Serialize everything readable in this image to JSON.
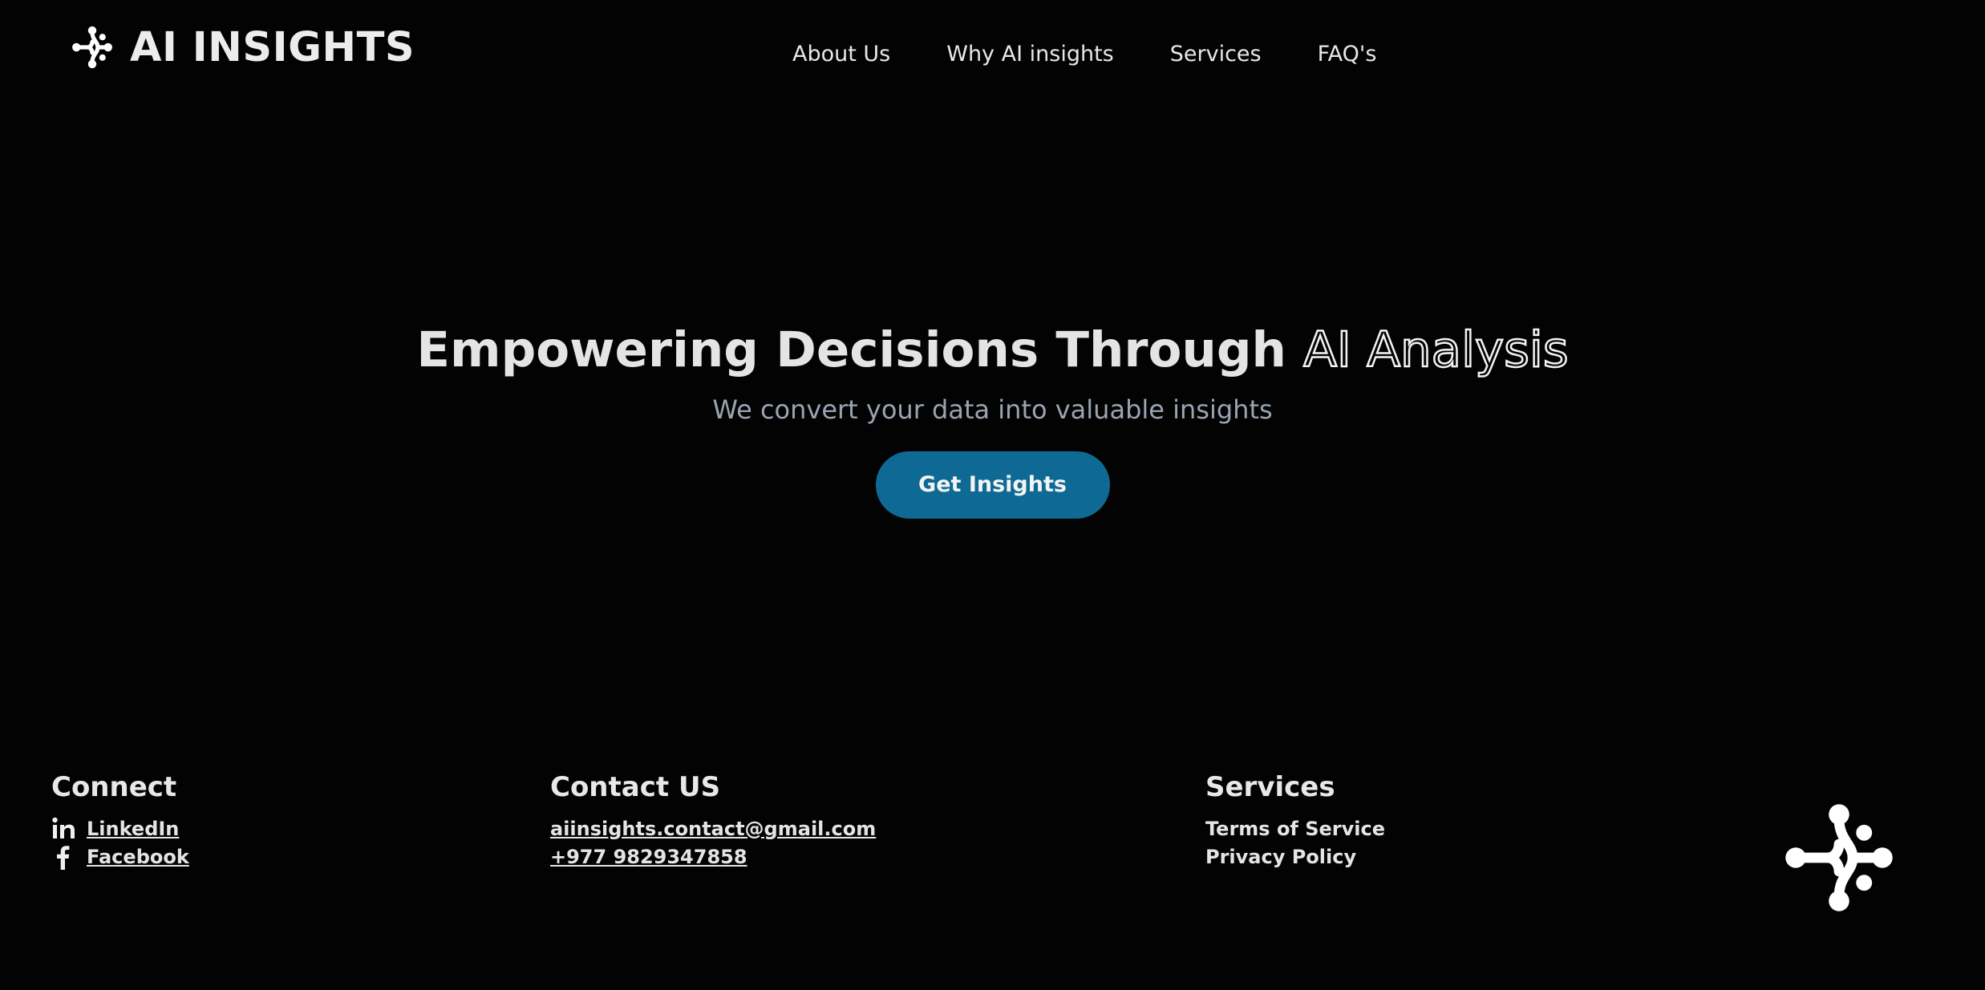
{
  "header": {
    "brand_name": "AI INSIGHTS",
    "logo_icon": "ai-node-logo",
    "nav": [
      {
        "label": "About Us"
      },
      {
        "label": "Why AI insights"
      },
      {
        "label": "Services"
      },
      {
        "label": "FAQ's"
      }
    ]
  },
  "hero": {
    "title_main": "Empowering Decisions Through",
    "title_outline": "AI Analysis",
    "subtitle": "We convert your data into valuable insights",
    "cta_label": "Get Insights"
  },
  "footer": {
    "connect": {
      "heading": "Connect",
      "links": [
        {
          "icon": "linkedin-icon",
          "label": "LinkedIn"
        },
        {
          "icon": "facebook-icon",
          "label": "Facebook"
        }
      ]
    },
    "contact": {
      "heading": "Contact US",
      "email": "aiinsights.contact@gmail.com",
      "phone": "+977 9829347858"
    },
    "services": {
      "heading": "Services",
      "links": [
        "Terms of Service",
        "Privacy Policy"
      ]
    }
  },
  "colors": {
    "background": "#030303",
    "accent_button": "#0e6a94",
    "subtitle": "#9aa4b2",
    "text": "#e6e6e6"
  }
}
